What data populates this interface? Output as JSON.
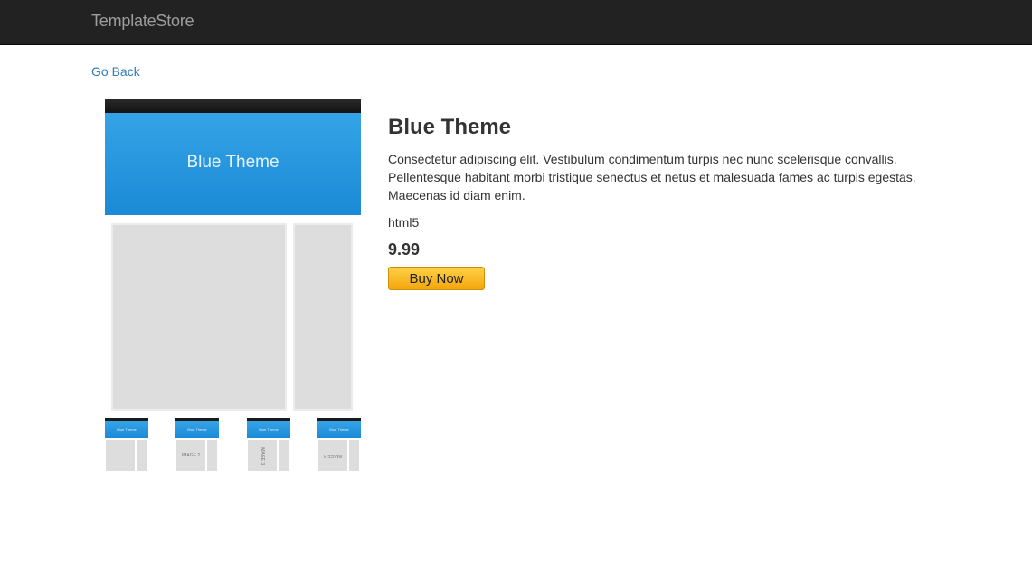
{
  "navbar": {
    "brand": "TemplateStore"
  },
  "nav": {
    "go_back": "Go Back"
  },
  "preview": {
    "hero_text": "Blue Theme",
    "thumbnails": [
      {
        "hero_text": "Blue Theme",
        "image_label": ""
      },
      {
        "hero_text": "Blue Theme",
        "image_label": "IMAGE 2"
      },
      {
        "hero_text": "Blue Theme",
        "image_label": "IMAGE 3"
      },
      {
        "hero_text": "Blue Theme",
        "image_label": "IMAGE 4"
      }
    ]
  },
  "product": {
    "title": "Blue Theme",
    "description": "Consectetur adipiscing elit. Vestibulum condimentum turpis nec nunc scelerisque convallis. Pellentesque habitant morbi tristique senectus et netus et malesuada fames ac turpis egestas. Maecenas id diam enim.",
    "tag": "html5",
    "price": "9.99",
    "buy_label": "Buy Now"
  },
  "colors": {
    "navbar_bg": "#222222",
    "link": "#337ab7",
    "hero_blue": "#2a97de",
    "buy_button": "#f8b62a"
  }
}
